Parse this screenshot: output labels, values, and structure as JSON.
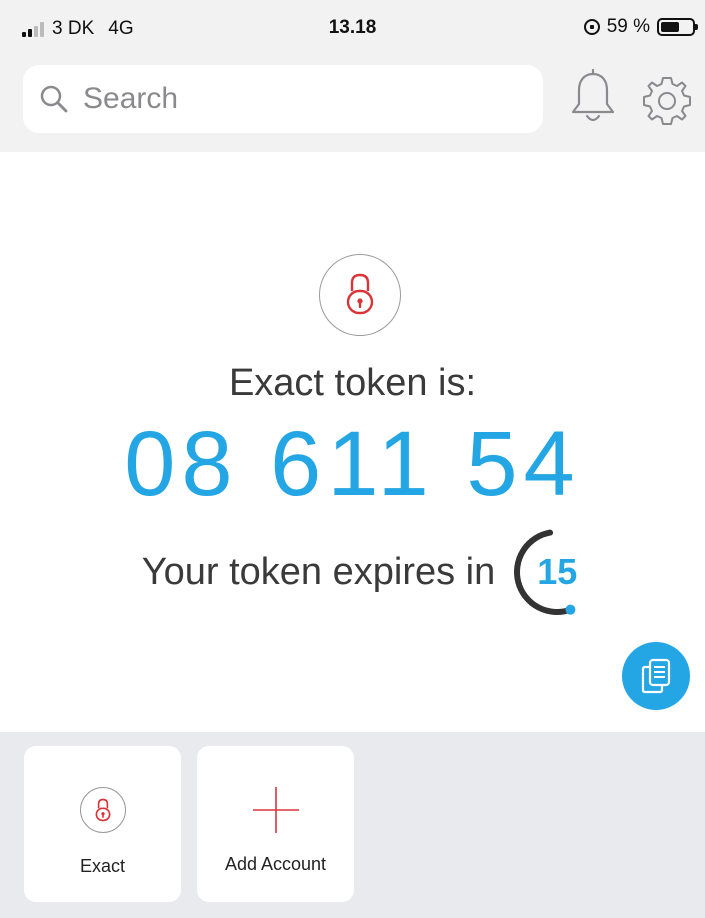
{
  "status_bar": {
    "carrier": "3 DK",
    "network": "4G",
    "time": "13.18",
    "battery_label": "59 %",
    "battery_level": 0.59
  },
  "header": {
    "search_placeholder": "Search"
  },
  "token": {
    "label": "Exact token is:",
    "code": "08 611 54",
    "expire_label": "Your token expires in",
    "seconds_left": "15",
    "timer_fraction": 0.5
  },
  "accounts": [
    {
      "label": "Exact",
      "icon": "lock-icon"
    },
    {
      "label": "Add Account",
      "icon": "plus-icon"
    }
  ],
  "colors": {
    "accent": "#23a6e3",
    "lock_red": "#d9343a",
    "timer_ring": "#333333"
  }
}
